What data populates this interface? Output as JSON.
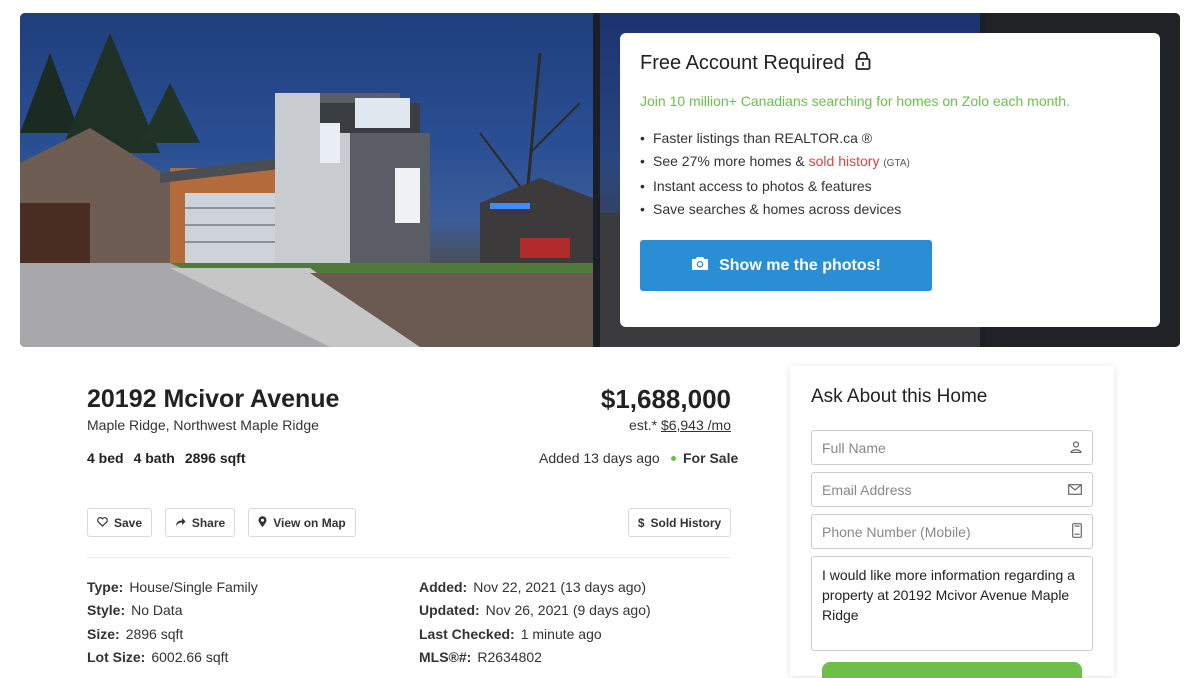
{
  "gallery": {
    "overlay": {
      "title": "Free Account Required",
      "subtitle": "Join 10 million+ Canadians searching for homes on Zolo each month.",
      "bullets": {
        "b1": "Faster listings than REALTOR.ca ®",
        "b2_pre": "See 27% more homes & ",
        "b2_red": "sold history",
        "b2_small": "(GTA)",
        "b3": "Instant access to photos & features",
        "b4": "Save searches & homes across devices"
      },
      "cta_label": "Show me the photos!"
    }
  },
  "listing": {
    "address": "20192 Mcivor Avenue",
    "area": "Maple Ridge, Northwest Maple Ridge",
    "price": "$1,688,000",
    "est_prefix": "est.*",
    "est_value": "$6,943 /mo",
    "beds": "4 bed",
    "baths": "4 bath",
    "sqft": "2896 sqft",
    "added": "Added 13 days ago",
    "status": "For Sale"
  },
  "actions": {
    "save": "Save",
    "share": "Share",
    "map": "View on Map",
    "sold_history": "Sold History"
  },
  "specs": {
    "type_label": "Type:",
    "type_value": "House/Single Family",
    "style_label": "Style:",
    "style_value": "No Data",
    "size_label": "Size:",
    "size_value": "2896 sqft",
    "lot_label": "Lot Size:",
    "lot_value": "6002.66 sqft",
    "added_label": "Added:",
    "added_value": "Nov 22, 2021 (13 days ago)",
    "updated_label": "Updated:",
    "updated_value": "Nov 26, 2021 (9 days ago)",
    "checked_label": "Last Checked:",
    "checked_value": "1 minute ago",
    "mls_label": "MLS®#:",
    "mls_value": "R2634802"
  },
  "form": {
    "title": "Ask About this Home",
    "name_placeholder": "Full Name",
    "email_placeholder": "Email Address",
    "phone_placeholder": "Phone Number (Mobile)",
    "message": "I would like more information regarding a property at 20192 Mcivor Avenue Maple Ridge"
  },
  "colors": {
    "accent_blue": "#2a8ed4",
    "accent_green": "#6cc04a",
    "sold_red": "#e53e3e"
  }
}
